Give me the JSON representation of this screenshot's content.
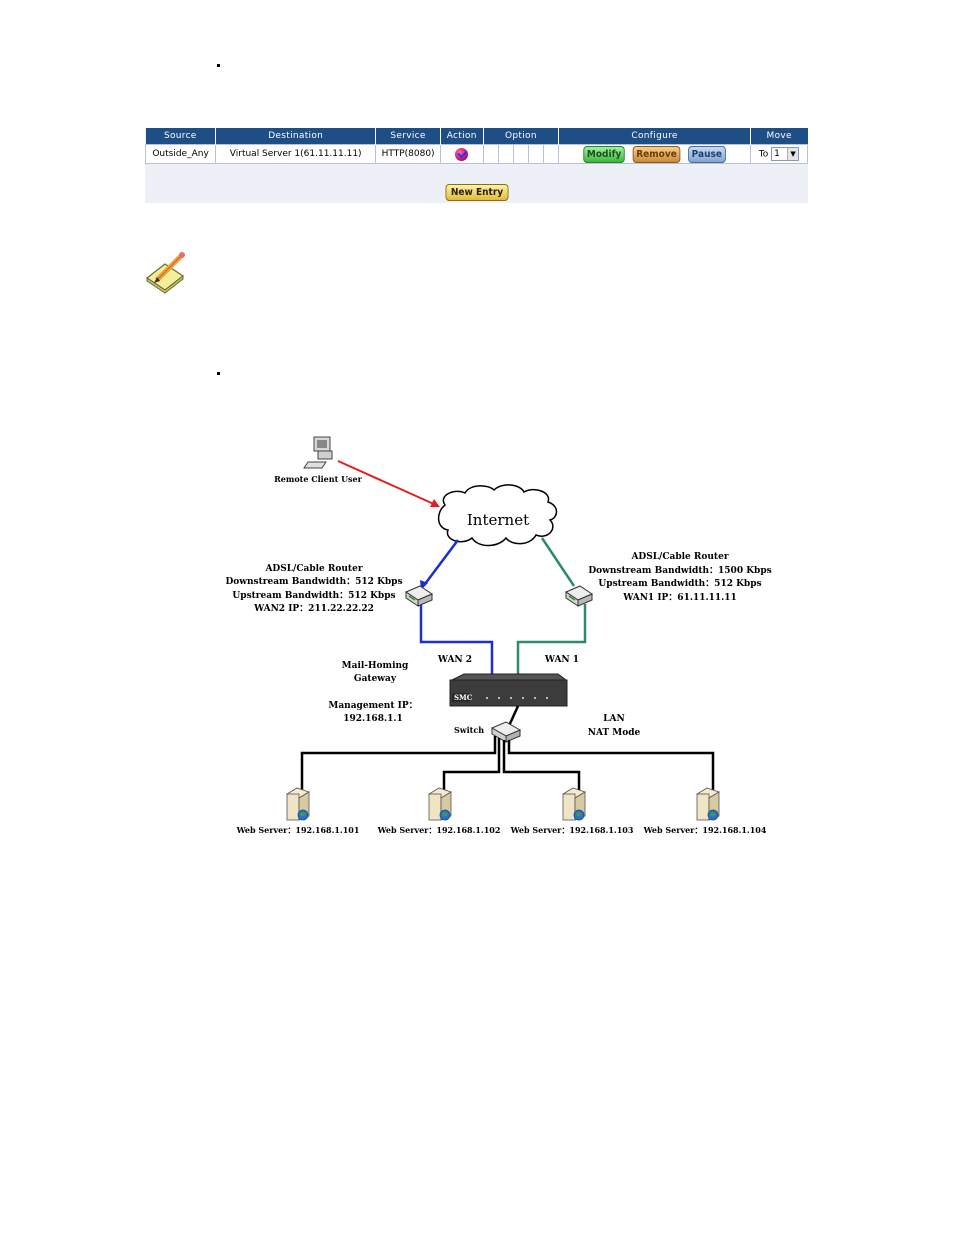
{
  "table": {
    "headers": [
      "Source",
      "Destination",
      "Service",
      "Action",
      "Option",
      "Configure",
      "Move"
    ],
    "rows": [
      {
        "source": "Outside_Any",
        "destination": "Virtual Server 1(61.11.11.11)",
        "service": "HTTP(8080)",
        "action_icon": "permit-icon",
        "configure": {
          "modify": "Modify",
          "remove": "Remove",
          "pause": "Pause"
        },
        "move": {
          "prefix": "To",
          "value": "1"
        }
      }
    ],
    "new_entry_label": "New Entry"
  },
  "note_icon": "notepad-pencil-icon",
  "diagram": {
    "remote_client": "Remote Client User",
    "internet": "Internet",
    "router_wan2": {
      "title": "ADSL/Cable Router",
      "downstream": "Downstream Bandwidth：512 Kbps",
      "upstream": "Upstream Bandwidth：512 Kbps",
      "ip": "WAN2 IP：211.22.22.22"
    },
    "router_wan1": {
      "title": "ADSL/Cable Router",
      "downstream": "Downstream Bandwidth：1500 Kbps",
      "upstream": "Upstream Bandwidth：512 Kbps",
      "ip": "WAN1 IP：61.11.11.11"
    },
    "wan2_label": "WAN 2",
    "wan1_label": "WAN 1",
    "gateway_line1": "Mail-Homing",
    "gateway_line2": "Gateway",
    "mgmt_line1": "Management IP：",
    "mgmt_line2": "192.168.1.1",
    "switch_label": "Switch",
    "lan_line1": "LAN",
    "lan_line2": "NAT Mode",
    "device_brand": "SMC",
    "servers": [
      "Web Server：192.168.1.101",
      "Web Server：192.168.1.102",
      "Web Server：192.168.1.103",
      "Web Server：192.168.1.104"
    ],
    "colors": {
      "client_link": "#e02020",
      "wan2_link": "#1a2fd0",
      "wan1_link": "#2e8b6a",
      "lan_link": "#000000"
    }
  }
}
